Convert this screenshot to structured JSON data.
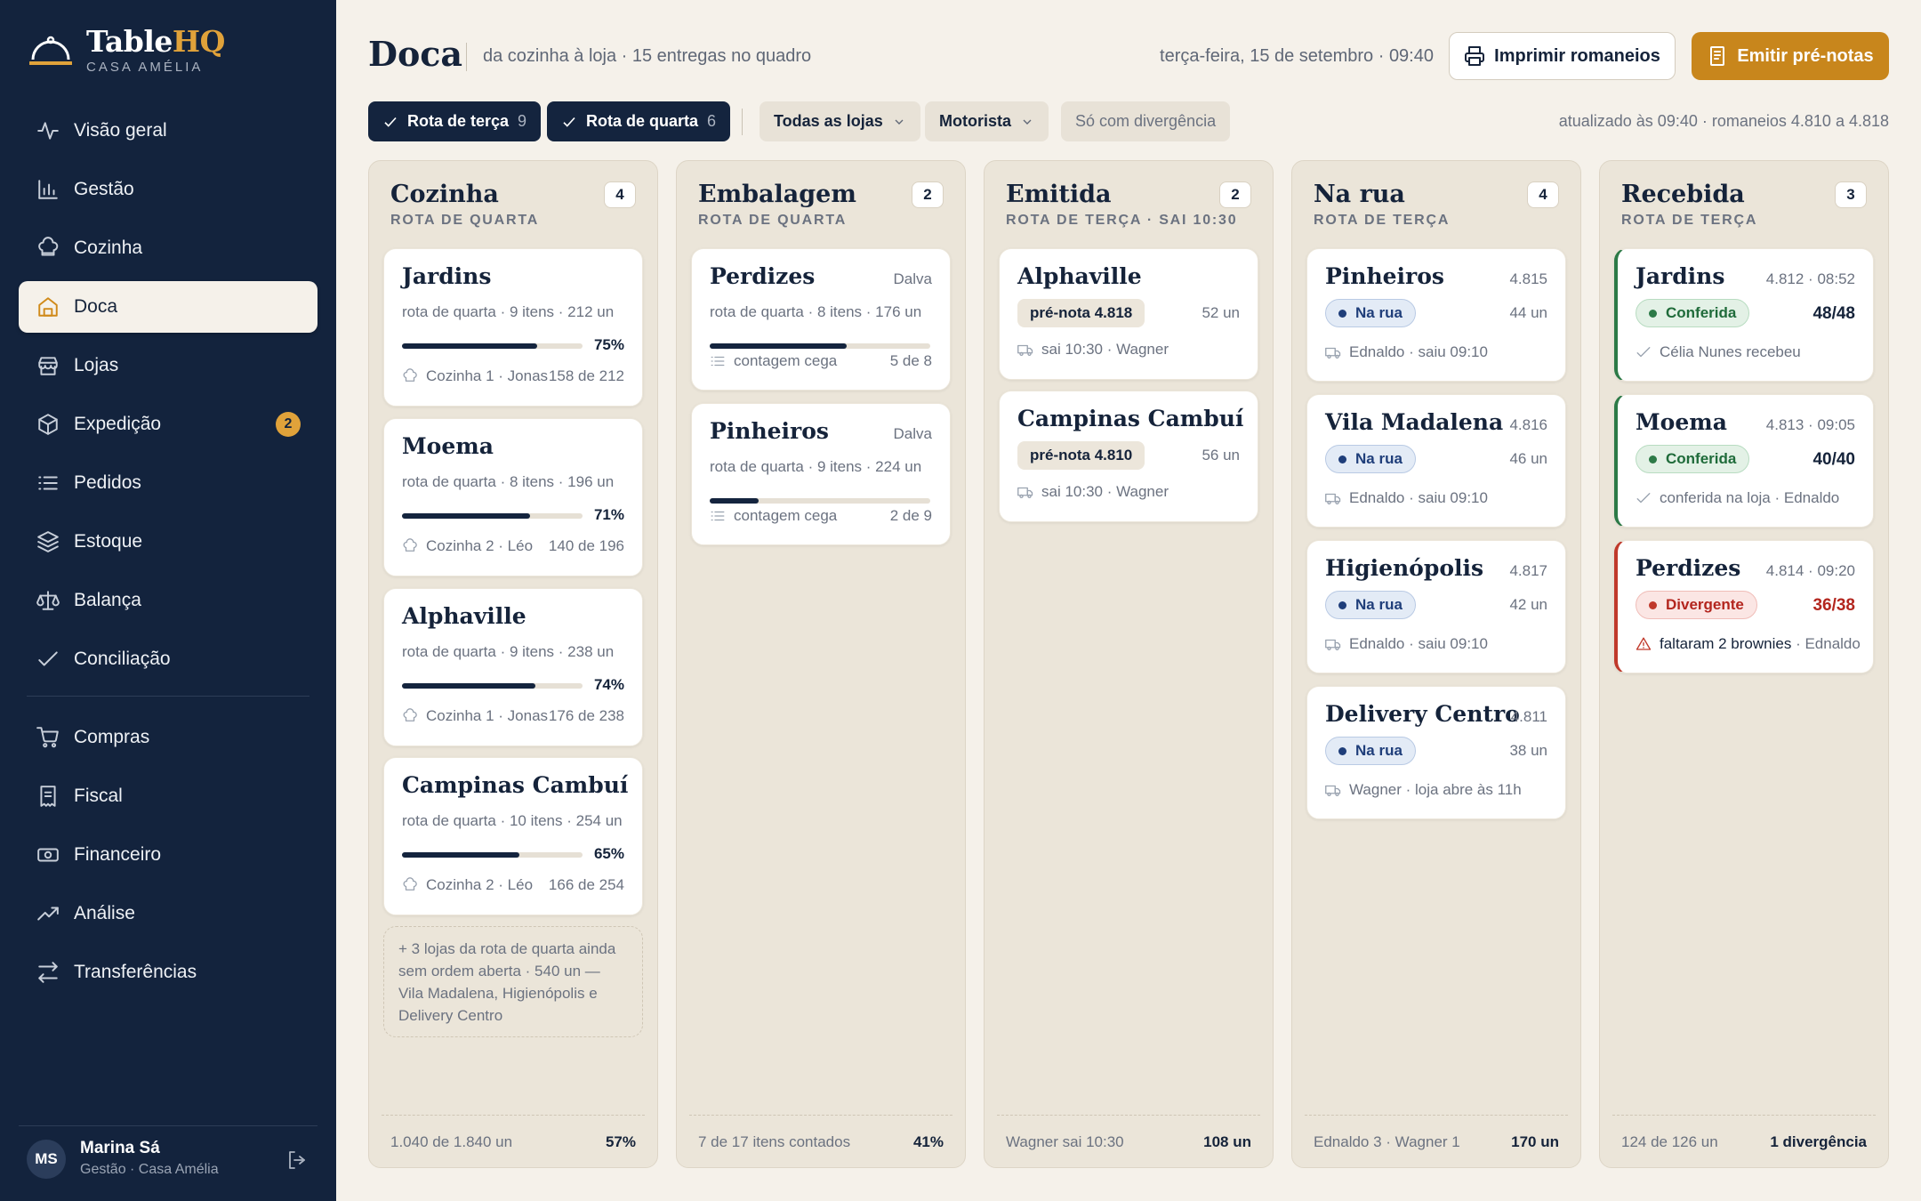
{
  "app": {
    "brand_main": "Table",
    "brand_accent": "HQ",
    "brand_sub": "CASA AMÉLIA"
  },
  "nav": {
    "items": [
      {
        "label": "Visão geral",
        "icon": "pulse-icon"
      },
      {
        "label": "Gestão",
        "icon": "bar-chart-icon"
      },
      {
        "label": "Cozinha",
        "icon": "chef-hat-icon"
      },
      {
        "label": "Doca",
        "icon": "home-dock-icon",
        "active": true
      },
      {
        "label": "Lojas",
        "icon": "store-icon"
      },
      {
        "label": "Expedição",
        "icon": "box-icon",
        "badge": "2"
      },
      {
        "label": "Pedidos",
        "icon": "list-icon"
      },
      {
        "label": "Estoque",
        "icon": "layers-icon"
      },
      {
        "label": "Balança",
        "icon": "scale-icon"
      },
      {
        "label": "Conciliação",
        "icon": "check-icon"
      },
      {
        "label": "Compras",
        "icon": "cart-icon"
      },
      {
        "label": "Fiscal",
        "icon": "receipt-icon"
      },
      {
        "label": "Financeiro",
        "icon": "cash-icon"
      },
      {
        "label": "Análise",
        "icon": "trend-icon"
      },
      {
        "label": "Transferências",
        "icon": "transfer-icon"
      }
    ]
  },
  "user": {
    "initials": "MS",
    "name": "Marina Sá",
    "role": "Gestão · Casa Amélia"
  },
  "header": {
    "title": "Doca",
    "subtitle": "da cozinha à loja · 15 entregas no quadro",
    "date": "terça-feira, 15 de setembro · 09:40",
    "print_label": "Imprimir romaneios",
    "emit_label": "Emitir pré-notas"
  },
  "filters": {
    "route_tue": {
      "label": "Rota de terça",
      "count": "9"
    },
    "route_wed": {
      "label": "Rota de quarta",
      "count": "6"
    },
    "stores": "Todas as lojas",
    "driver": "Motorista",
    "divergence": "Só com divergência",
    "updated": "atualizado às 09:40 · romaneios 4.810 a 4.818"
  },
  "columns": {
    "cozinha": {
      "title": "Cozinha",
      "count": "4",
      "sub": "ROTA DE QUARTA",
      "cards": [
        {
          "title": "Jardins",
          "line": "rota de quarta · 9 itens · 212 un",
          "progress": 75,
          "pct": "75%",
          "who": "Cozinha 1 · Jonas",
          "qty": "158 de 212"
        },
        {
          "title": "Moema",
          "line": "rota de quarta · 8 itens · 196 un",
          "progress": 71,
          "pct": "71%",
          "who": "Cozinha 2 · Léo",
          "qty": "140 de 196"
        },
        {
          "title": "Alphaville",
          "line": "rota de quarta · 9 itens · 238 un",
          "progress": 74,
          "pct": "74%",
          "who": "Cozinha 1 · Jonas",
          "qty": "176 de 238"
        },
        {
          "title": "Campinas Cambuí",
          "line": "rota de quarta · 10 itens · 254 un",
          "progress": 65,
          "pct": "65%",
          "who": "Cozinha 2 · Léo",
          "qty": "166 de 254"
        }
      ],
      "note": "+ 3 lojas da rota de quarta ainda sem ordem aberta · 540 un — Vila Madalena, Higienópolis e Delivery Centro",
      "foot_l": "1.040 de 1.840 un",
      "foot_r": "57%"
    },
    "embalagem": {
      "title": "Embalagem",
      "count": "2",
      "sub": "ROTA DE QUARTA",
      "cards": [
        {
          "title": "Perdizes",
          "meta": "Dalva",
          "line": "rota de quarta · 8 itens · 176 un",
          "progress": 62,
          "mode": "contagem cega",
          "qty": "5 de 8"
        },
        {
          "title": "Pinheiros",
          "meta": "Dalva",
          "line": "rota de quarta · 9 itens · 224 un",
          "progress": 22,
          "mode": "contagem cega",
          "qty": "2 de 9"
        }
      ],
      "foot_l": "7 de 17 itens contados",
      "foot_r": "41%"
    },
    "emitida": {
      "title": "Emitida",
      "count": "2",
      "sub": "ROTA DE TERÇA · SAI 10:30",
      "cards": [
        {
          "title": "Alphaville",
          "pill": "pré-nota 4.818",
          "qty": "52 un",
          "ship": "sai 10:30 · Wagner"
        },
        {
          "title": "Campinas Cambuí",
          "pill": "pré-nota 4.810",
          "qty": "56 un",
          "ship": "sai 10:30 · Wagner"
        }
      ],
      "foot_l": "Wagner sai 10:30",
      "foot_r": "108 un"
    },
    "narua": {
      "title": "Na rua",
      "count": "4",
      "sub": "ROTA DE TERÇA",
      "cards": [
        {
          "title": "Pinheiros",
          "meta": "4.815",
          "pill": "Na rua",
          "qty": "44 un",
          "ship": "Ednaldo · saiu 09:10"
        },
        {
          "title": "Vila Madalena",
          "meta": "4.816",
          "pill": "Na rua",
          "qty": "46 un",
          "ship": "Ednaldo · saiu 09:10"
        },
        {
          "title": "Higienópolis",
          "meta": "4.817",
          "pill": "Na rua",
          "qty": "42 un",
          "ship": "Ednaldo · saiu 09:10"
        },
        {
          "title": "Delivery Centro",
          "meta": "4.811",
          "pill": "Na rua",
          "qty": "38 un",
          "ship": "Wagner · loja abre às 11h"
        }
      ],
      "foot_l": "Ednaldo 3 · Wagner 1",
      "foot_r": "170 un"
    },
    "recebida": {
      "title": "Recebida",
      "count": "3",
      "sub": "ROTA DE TERÇA",
      "cards": [
        {
          "title": "Jardins",
          "meta": "4.812 · 08:52",
          "pill": "Conferida",
          "qty": "48/48",
          "note": "Célia Nunes recebeu"
        },
        {
          "title": "Moema",
          "meta": "4.813 · 09:05",
          "pill": "Conferida",
          "qty": "40/40",
          "note": "conferida na loja · Ednaldo"
        },
        {
          "title": "Perdizes",
          "meta": "4.814 · 09:20",
          "pill": "Divergente",
          "qty": "36/38",
          "note": "faltaram 2 brownies",
          "note2": " · Ednaldo"
        }
      ],
      "foot_l": "124 de 126 un",
      "foot_r": "1 divergência"
    }
  },
  "colors": {
    "navy": "#13233d",
    "gold": "#c8861c",
    "green": "#2c7a47",
    "red": "#c0392b",
    "blue": "#1f3e7a"
  }
}
